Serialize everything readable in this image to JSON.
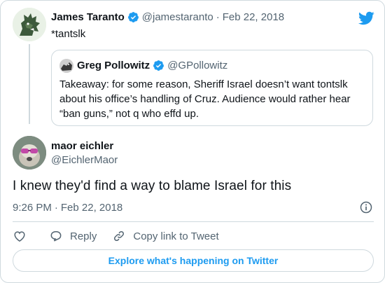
{
  "parent_tweet": {
    "name": "James Taranto",
    "handle": "@jamestaranto",
    "separator": "·",
    "date": "Feb 22, 2018",
    "text": "*tantslk"
  },
  "quoted_tweet": {
    "name": "Greg Pollowitz",
    "handle": "@GPollowitz",
    "text": "Takeaway: for some reason, Sheriff Israel doesn’t want tontslk about his office’s handling of Cruz. Audience would rather hear “ban guns,” not q who effd up."
  },
  "main_tweet": {
    "name": "maor eichler",
    "handle": "@EichlerMaor",
    "text": "I knew they'd find a way to blame Israel for this",
    "time": "9:26 PM",
    "separator": "·",
    "date": "Feb 22, 2018"
  },
  "actions": {
    "reply_label": "Reply",
    "copy_link_label": "Copy link to Tweet"
  },
  "explore_label": "Explore what's happening on Twitter",
  "icons": {
    "brand": "twitter-bird-icon",
    "verified": "verified-badge-icon",
    "like": "heart-icon",
    "reply": "reply-icon",
    "copy_link": "link-icon",
    "info": "info-icon"
  },
  "colors": {
    "brand_blue": "#1d9bf0",
    "text_primary": "#0f1419",
    "text_secondary": "#536471",
    "border": "#cfd9de"
  }
}
